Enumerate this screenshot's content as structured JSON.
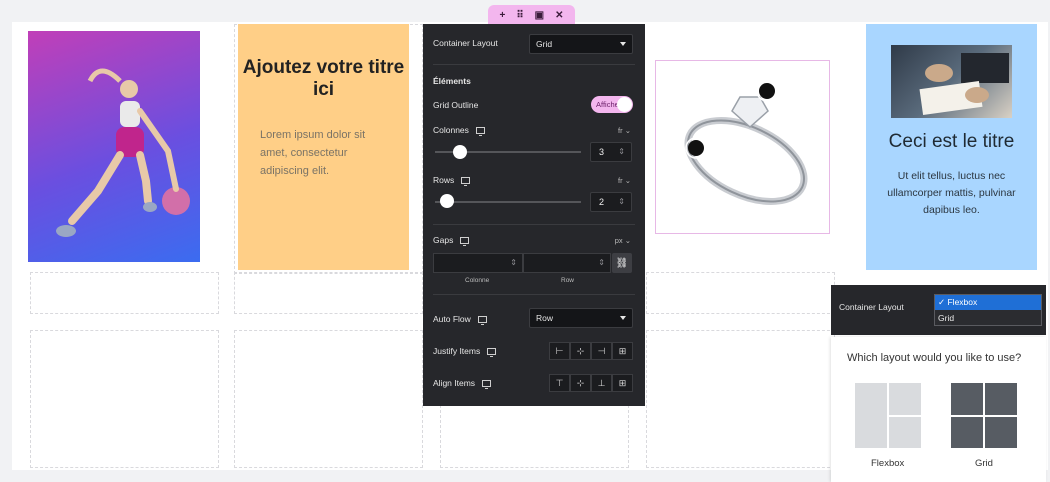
{
  "top_toolbar": {
    "icons": [
      "plus-icon",
      "drag-handle-icon",
      "duplicate-icon",
      "close-icon"
    ],
    "glyphs": [
      "+",
      "⠿",
      "▣",
      "✕"
    ],
    "accent_color": "#f3b6ee"
  },
  "canvas": {
    "card_orange": {
      "title": "Ajoutez votre titre ici",
      "body": "Lorem ipsum dolor sit amet, consectetur adipiscing elit."
    },
    "card_blue": {
      "title": "Ceci est le titre",
      "body": "Ut elit tellus, luctus nec ullamcorper mattis, pulvinar dapibus leo."
    }
  },
  "panel": {
    "container_layout_label": "Container Layout",
    "container_layout_value": "Grid",
    "elements_heading": "Éléments",
    "grid_outline_label": "Grid Outline",
    "grid_outline_toggle": "Affiche",
    "columns_label": "Colonnes",
    "columns_unit": "fr ⌄",
    "columns_value": "3",
    "rows_label": "Rows",
    "rows_unit": "fr ⌄",
    "rows_value": "2",
    "gaps_label": "Gaps",
    "gaps_unit": "px ⌄",
    "gap_column_label": "Colonne",
    "gap_row_label": "Row",
    "auto_flow_label": "Auto Flow",
    "auto_flow_value": "Row",
    "justify_items_label": "Justify Items",
    "justify_icons": [
      "⊢",
      "⊹",
      "⊣",
      "⊞"
    ],
    "align_items_label": "Align Items",
    "align_icons": [
      "⊤",
      "⊹",
      "⊥",
      "⊞"
    ]
  },
  "layout_dropdown": {
    "label": "Container Layout",
    "options": [
      "✓ Flexbox",
      "Grid"
    ],
    "selected_color": "#1f6fd6"
  },
  "layout_picker": {
    "question": "Which layout would you like to use?",
    "flexbox_label": "Flexbox",
    "grid_label": "Grid"
  }
}
